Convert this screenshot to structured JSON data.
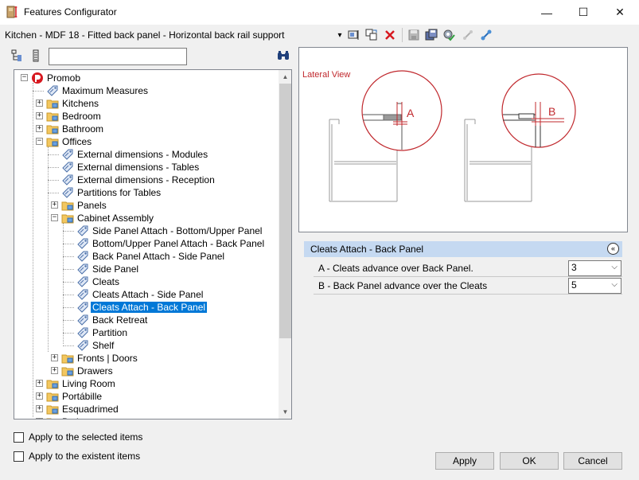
{
  "window": {
    "title": "Features Configurator",
    "controls": {
      "minimize": "—",
      "maximize": "☐",
      "close": "✕"
    }
  },
  "toolbar": {
    "path": "Kitchen - MDF 18 - Fitted back panel - Horizontal back rail support",
    "dropdown_glyph": "▾",
    "icons": [
      "select-items-icon",
      "copy-paste-icon",
      "delete-icon",
      "save-icon",
      "save-all-icon",
      "settings-check-icon",
      "link-disabled-icon",
      "link-icon"
    ],
    "accent_delete": "#d71920"
  },
  "tree_search": {
    "value": "",
    "placeholder": ""
  },
  "tree": [
    {
      "label": "Promob",
      "icon": "promob-logo-icon",
      "expand": "−"
    },
    {
      "label": "Maximum Measures",
      "icon": "tag-icon"
    },
    {
      "label": "Kitchens",
      "icon": "folder-icon",
      "expand": "+"
    },
    {
      "label": "Bedroom",
      "icon": "folder-icon",
      "expand": "+"
    },
    {
      "label": "Bathroom",
      "icon": "folder-icon",
      "expand": "+"
    },
    {
      "label": "Offices",
      "icon": "folder-icon",
      "expand": "−"
    },
    {
      "label": "External dimensions - Modules",
      "icon": "tag-icon"
    },
    {
      "label": "External dimensions - Tables",
      "icon": "tag-icon"
    },
    {
      "label": "External dimensions - Reception",
      "icon": "tag-icon"
    },
    {
      "label": "Partitions for Tables",
      "icon": "tag-icon"
    },
    {
      "label": "Panels",
      "icon": "folder-icon",
      "expand": "+"
    },
    {
      "label": "Cabinet Assembly",
      "icon": "folder-icon",
      "expand": "−"
    },
    {
      "label": "Side Panel Attach - Bottom/Upper Panel",
      "icon": "tag-icon"
    },
    {
      "label": " Bottom/Upper Panel Attach - Back Panel",
      "icon": "tag-icon"
    },
    {
      "label": "Back Panel Attach - Side Panel",
      "icon": "tag-icon"
    },
    {
      "label": "Side Panel",
      "icon": "tag-icon"
    },
    {
      "label": "Cleats",
      "icon": "tag-icon"
    },
    {
      "label": "Cleats Attach - Side Panel",
      "icon": "tag-icon"
    },
    {
      "label": "Cleats Attach - Back Panel",
      "icon": "tag-icon",
      "selected": true
    },
    {
      "label": "Back Retreat",
      "icon": "tag-icon"
    },
    {
      "label": "Partition",
      "icon": "tag-icon"
    },
    {
      "label": "Shelf",
      "icon": "tag-icon"
    },
    {
      "label": "Fronts | Doors",
      "icon": "folder-icon",
      "expand": "+"
    },
    {
      "label": "Drawers",
      "icon": "folder-icon",
      "expand": "+"
    },
    {
      "label": "Living Room",
      "icon": "folder-icon",
      "expand": "+"
    },
    {
      "label": "Portábille",
      "icon": "folder-icon",
      "expand": "+"
    },
    {
      "label": "Esquadrimed",
      "icon": "folder-icon",
      "expand": "+"
    },
    {
      "label": "Bydn",
      "icon": "folder-icon",
      "expand": "+"
    }
  ],
  "checkboxes": {
    "apply_selected": "Apply to the selected items",
    "apply_existent": "Apply to the existent items"
  },
  "preview": {
    "label": "Lateral View",
    "marker_a": "A",
    "marker_b": "B",
    "color": "#c0282d"
  },
  "properties": {
    "header": "Cleats Attach - Back Panel",
    "collapse_glyph": "«",
    "rows": [
      {
        "label": "A - Cleats advance over Back Panel.",
        "value": "3"
      },
      {
        "label": "B - Back Panel advance over the Cleats",
        "value": "5"
      }
    ],
    "caret": "⌵"
  },
  "buttons": {
    "apply": "Apply",
    "ok": "OK",
    "cancel": "Cancel"
  }
}
